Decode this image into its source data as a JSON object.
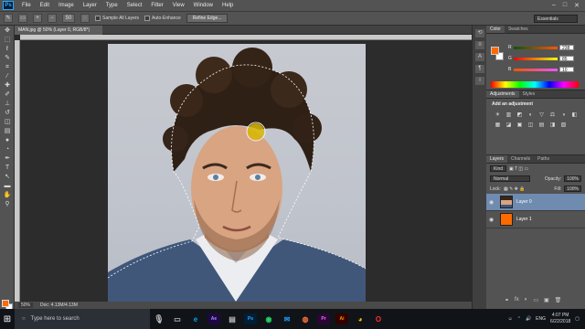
{
  "app": {
    "logo": "Ps"
  },
  "menu": [
    "File",
    "Edit",
    "Image",
    "Layer",
    "Type",
    "Select",
    "Filter",
    "View",
    "Window",
    "Help"
  ],
  "window_controls": [
    "–",
    "□",
    "✕"
  ],
  "options": {
    "size_value": "50",
    "sample_all_layers": "Sample All Layers",
    "auto_enhance": "Auto-Enhance",
    "refine_edge": "Refine Edge...",
    "workspace": "Essentials"
  },
  "document": {
    "tab_title": "MAN.jpg @ 50% (Layer 0, RGB/8*)",
    "zoom": "50%",
    "doc_size": "Doc: 4.13M/4.13M"
  },
  "color_panel": {
    "tabs": [
      "Color",
      "Swatches"
    ],
    "sliders": [
      {
        "label": "R",
        "value": "238",
        "color": "#ff3b1f"
      },
      {
        "label": "G",
        "value": "85",
        "color": "#28b828"
      },
      {
        "label": "B",
        "value": "10",
        "color": "#2f5bff"
      }
    ],
    "fg_color": "#ff6a00"
  },
  "adjustments": {
    "tabs": [
      "Adjustments",
      "Styles"
    ],
    "title": "Add an adjustment",
    "icons": [
      "☀",
      "▥",
      "◩",
      "◐",
      "▽",
      "⚖",
      "◑",
      "◧",
      "▦",
      "◪",
      "▣",
      "◫",
      "▤",
      "◨",
      "▧"
    ]
  },
  "layers_panel": {
    "tabs": [
      "Layers",
      "Channels",
      "Paths"
    ],
    "kind": "Kind",
    "blend_mode": "Normal",
    "opacity_label": "Opacity:",
    "opacity_value": "100%",
    "lock_label": "Lock:",
    "fill_label": "Fill:",
    "fill_value": "100%",
    "layers": [
      {
        "name": "Layer 0",
        "active": true
      },
      {
        "name": "Layer 1",
        "active": false,
        "fill": "#ff6a00"
      }
    ],
    "footer_icons": [
      "⚭",
      "fx",
      "◐",
      "▭",
      "▣",
      "🗑"
    ]
  },
  "taskbar": {
    "search_placeholder": "Type here to search",
    "apps": [
      {
        "name": "After Effects",
        "label": "Ae",
        "color": "#9999ff",
        "bg": "#1f0740"
      },
      {
        "name": "Photoshop",
        "label": "Ps",
        "color": "#31a8ff",
        "bg": "#001e36"
      },
      {
        "name": "Premiere",
        "label": "Pr",
        "color": "#ea77ff",
        "bg": "#2a0634"
      },
      {
        "name": "Illustrator",
        "label": "Ai",
        "color": "#ff9a00",
        "bg": "#330000"
      }
    ],
    "language": "ENG",
    "time": "4:07 PM",
    "date": "6/22/2018"
  }
}
